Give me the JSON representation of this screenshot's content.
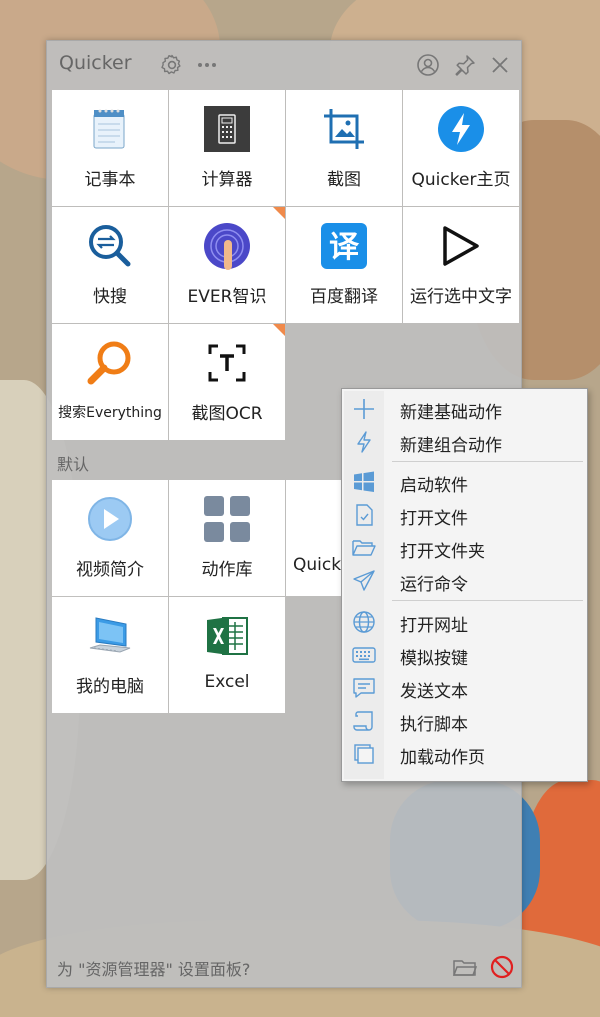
{
  "panel": {
    "title": "Quicker",
    "section_label": "默认",
    "footer_text": "为 \"资源管理器\" 设置面板?"
  },
  "top_tiles": [
    {
      "label": "记事本",
      "icon": "notepad-icon"
    },
    {
      "label": "计算器",
      "icon": "calculator-icon"
    },
    {
      "label": "截图",
      "icon": "screenshot-icon"
    },
    {
      "label": "Quicker主页",
      "icon": "lightning-icon"
    },
    {
      "label": "快搜",
      "icon": "quick-search-icon"
    },
    {
      "label": "EVER智识",
      "icon": "ever-icon",
      "badge": true
    },
    {
      "label": "百度翻译",
      "icon": "translate-icon"
    },
    {
      "label": "运行选中文字",
      "icon": "play-icon"
    },
    {
      "label": "搜索Everything",
      "icon": "everything-search-icon"
    },
    {
      "label": "截图OCR",
      "icon": "ocr-icon",
      "badge": true
    }
  ],
  "default_tiles": [
    {
      "label": "视频简介",
      "icon": "video-play-icon"
    },
    {
      "label": "动作库",
      "icon": "action-library-icon"
    },
    {
      "label": "Quick",
      "icon": "quicker-logo-icon"
    },
    {
      "label": "我的电脑",
      "icon": "computer-icon"
    },
    {
      "label": "Excel",
      "icon": "excel-icon"
    }
  ],
  "context_menu": {
    "items": [
      {
        "label": "新建基础动作",
        "icon": "plus-icon"
      },
      {
        "label": "新建组合动作",
        "icon": "lightning-outline-icon"
      },
      {
        "label": "启动软件",
        "icon": "windows-icon"
      },
      {
        "label": "打开文件",
        "icon": "file-check-icon"
      },
      {
        "label": "打开文件夹",
        "icon": "folder-open-icon"
      },
      {
        "label": "运行命令",
        "icon": "paper-plane-icon"
      },
      {
        "label": "打开网址",
        "icon": "globe-icon"
      },
      {
        "label": "模拟按键",
        "icon": "keyboard-icon"
      },
      {
        "label": "发送文本",
        "icon": "chat-icon"
      },
      {
        "label": "执行脚本",
        "icon": "script-icon"
      },
      {
        "label": "加载动作页",
        "icon": "pages-icon"
      }
    ]
  },
  "colors": {
    "accent_blue": "#1a8fe8",
    "badge_orange": "#f08a4b",
    "panel_bg": "#bebebe",
    "menu_icon_blue": "#5b9bd5"
  }
}
